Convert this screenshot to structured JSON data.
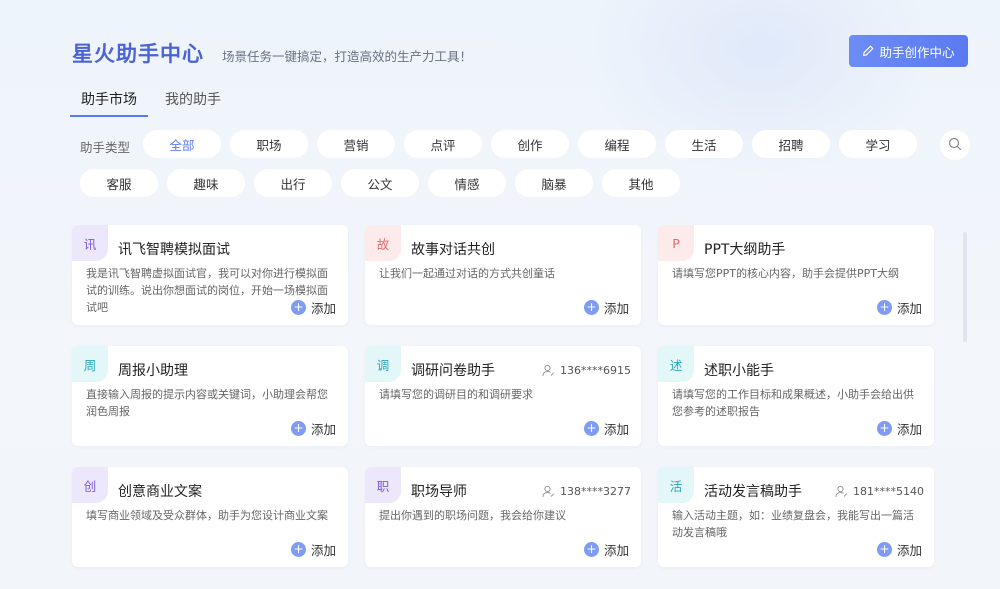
{
  "header": {
    "title": "星火助手中心",
    "subtitle": "场景任务一键搞定，打造高效的生产力工具！",
    "create_button": "助手创作中心"
  },
  "tabs": [
    {
      "label": "助手市场",
      "active": true
    },
    {
      "label": "我的助手",
      "active": false
    }
  ],
  "filters": {
    "label": "助手类型",
    "chips": [
      "全部",
      "职场",
      "营销",
      "点评",
      "创作",
      "编程",
      "生活",
      "招聘",
      "学习",
      "客服",
      "趣味",
      "出行",
      "公文",
      "情感",
      "脑暴",
      "其他"
    ],
    "active": "全部"
  },
  "search_icon": "search-icon",
  "cards": [
    {
      "badge": "讯",
      "badge_color": "#ede7fb",
      "badge_text_color": "#7b5bd6",
      "title": "讯飞智聘模拟面试",
      "author": "",
      "desc": "我是讯飞智聘虚拟面试官，我可以对你进行模拟面试的训练。说出你想面试的岗位，开始一场模拟面试吧",
      "add": "添加"
    },
    {
      "badge": "故",
      "badge_color": "#fdeaea",
      "badge_text_color": "#e06b6b",
      "title": "故事对话共创",
      "author": "",
      "desc": "让我们一起通过对话的方式共创童话",
      "add": "添加"
    },
    {
      "badge": "P",
      "badge_color": "#fdeaea",
      "badge_text_color": "#e06b6b",
      "title": "PPT大纲助手",
      "author": "",
      "desc": "请填写您PPT的核心内容，助手会提供PPT大纲",
      "add": "添加"
    },
    {
      "badge": "周",
      "badge_color": "#e3f6f8",
      "badge_text_color": "#2aa7b8",
      "title": "周报小助理",
      "author": "",
      "desc": "直接输入周报的提示内容或关键词，小助理会帮您润色周报",
      "add": "添加"
    },
    {
      "badge": "调",
      "badge_color": "#e3f6f8",
      "badge_text_color": "#2aa7b8",
      "title": "调研问卷助手",
      "author": "136****6915",
      "desc": "请填写您的调研目的和调研要求",
      "add": "添加"
    },
    {
      "badge": "述",
      "badge_color": "#e3f6f8",
      "badge_text_color": "#2aa7b8",
      "title": "述职小能手",
      "author": "",
      "desc": "请填写您的工作目标和成果概述，小助手会给出供您参考的述职报告",
      "add": "添加"
    },
    {
      "badge": "创",
      "badge_color": "#ede7fb",
      "badge_text_color": "#7b5bd6",
      "title": "创意商业文案",
      "author": "",
      "desc": "填写商业领域及受众群体，助手为您设计商业文案",
      "add": "添加"
    },
    {
      "badge": "职",
      "badge_color": "#ede7fb",
      "badge_text_color": "#7b5bd6",
      "title": "职场导师",
      "author": "138****3277",
      "desc": "提出你遇到的职场问题，我会给你建议",
      "add": "添加"
    },
    {
      "badge": "活",
      "badge_color": "#e3f6f8",
      "badge_text_color": "#2aa7b8",
      "title": "活动发言稿助手",
      "author": "181****5140",
      "desc": "输入活动主题，如：业绩复盘会，我能写出一篇活动发言稿哦",
      "add": "添加"
    }
  ]
}
